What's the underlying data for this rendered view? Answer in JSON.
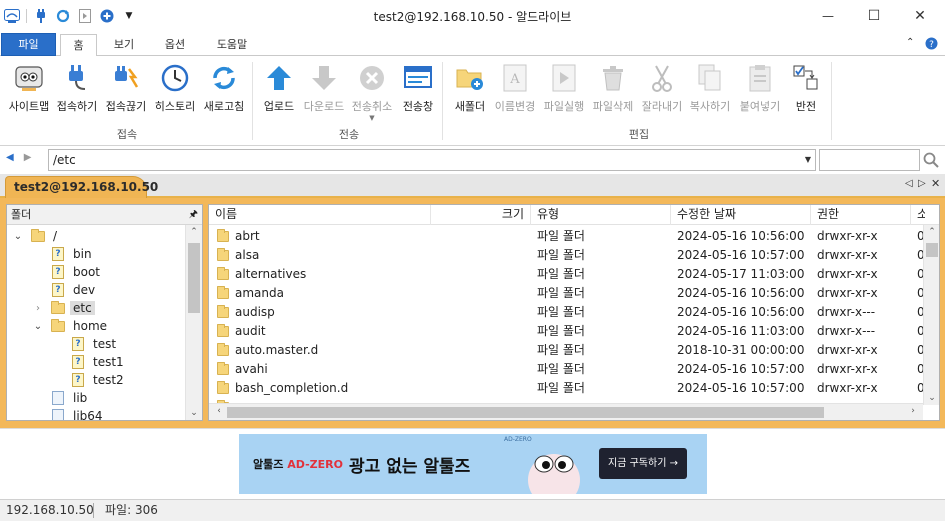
{
  "window": {
    "title": "test2@192.168.10.50 - 알드라이브",
    "minimize": "—",
    "maximize": "☐",
    "close": "✕"
  },
  "ribbon_tabs": [
    {
      "label": "파일"
    },
    {
      "label": "홈"
    },
    {
      "label": "보기"
    },
    {
      "label": "옵션"
    },
    {
      "label": "도움말"
    }
  ],
  "ribbon": {
    "connect_group": "접속",
    "transfer_group": "전송",
    "edit_group": "편집",
    "site_map": "사이트맵",
    "connect": "접속하기",
    "disconnect": "접속끊기",
    "history": "히스토리",
    "refresh": "새로고침",
    "upload": "업로드",
    "download": "다운로드",
    "cancel_transfer": "전송취소",
    "transfer_window": "전송창",
    "new_folder": "새폴더",
    "rename": "이름변경",
    "run_file": "파일실행",
    "delete_file": "파일삭제",
    "cut": "잘라내기",
    "copy": "복사하기",
    "paste": "붙여넣기",
    "invert": "반전"
  },
  "address": {
    "path": "/etc",
    "search_placeholder": ""
  },
  "session_tab": "test2@192.168.10.50",
  "folder_panel": {
    "title": "폴더",
    "tree": [
      {
        "label": "/",
        "icon": "folder",
        "expand": "open"
      },
      {
        "label": "bin",
        "icon": "link"
      },
      {
        "label": "boot",
        "icon": "link"
      },
      {
        "label": "dev",
        "icon": "link"
      },
      {
        "label": "etc",
        "icon": "folder",
        "expand": "closed"
      },
      {
        "label": "home",
        "icon": "folder",
        "expand": "open"
      },
      {
        "label": "test",
        "icon": "link"
      },
      {
        "label": "test1",
        "icon": "link"
      },
      {
        "label": "test2",
        "icon": "link"
      },
      {
        "label": "lib",
        "icon": "link"
      },
      {
        "label": "lib64",
        "icon": "link"
      }
    ]
  },
  "file_list": {
    "columns": [
      "이름",
      "크기",
      "유형",
      "수정한 날짜",
      "권한",
      "소"
    ],
    "rows": [
      {
        "name": "abrt",
        "size": "",
        "type": "파일 폴더",
        "date": "2024-05-16 10:56:00",
        "perm": "drwxr-xr-x",
        "owner": "0"
      },
      {
        "name": "alsa",
        "size": "",
        "type": "파일 폴더",
        "date": "2024-05-16 10:57:00",
        "perm": "drwxr-xr-x",
        "owner": "0"
      },
      {
        "name": "alternatives",
        "size": "",
        "type": "파일 폴더",
        "date": "2024-05-17 11:03:00",
        "perm": "drwxr-xr-x",
        "owner": "0"
      },
      {
        "name": "amanda",
        "size": "",
        "type": "파일 폴더",
        "date": "2024-05-16 10:56:00",
        "perm": "drwxr-xr-x",
        "owner": "0"
      },
      {
        "name": "audisp",
        "size": "",
        "type": "파일 폴더",
        "date": "2024-05-16 10:56:00",
        "perm": "drwxr-x---",
        "owner": "0"
      },
      {
        "name": "audit",
        "size": "",
        "type": "파일 폴더",
        "date": "2024-05-16 11:03:00",
        "perm": "drwxr-x---",
        "owner": "0"
      },
      {
        "name": "auto.master.d",
        "size": "",
        "type": "파일 폴더",
        "date": "2018-10-31 00:00:00",
        "perm": "drwxr-xr-x",
        "owner": "0"
      },
      {
        "name": "avahi",
        "size": "",
        "type": "파일 폴더",
        "date": "2024-05-16 10:57:00",
        "perm": "drwxr-xr-x",
        "owner": "0"
      },
      {
        "name": "bash_completion.d",
        "size": "",
        "type": "파일 폴더",
        "date": "2024-05-16 10:57:00",
        "perm": "drwxr-xr-x",
        "owner": "0"
      }
    ]
  },
  "ad": {
    "brand_prefix": "알툴즈",
    "brand_highlight": "AD-ZERO",
    "headline": "광고 없는 알툴즈",
    "cta": "지금 구독하기 →",
    "deco": "AD-ZERO"
  },
  "status": {
    "ip": "192.168.10.50",
    "files": "파일: 306"
  },
  "colors": {
    "accent_blue": "#2a6fc9",
    "session_orange": "#f0b554"
  }
}
